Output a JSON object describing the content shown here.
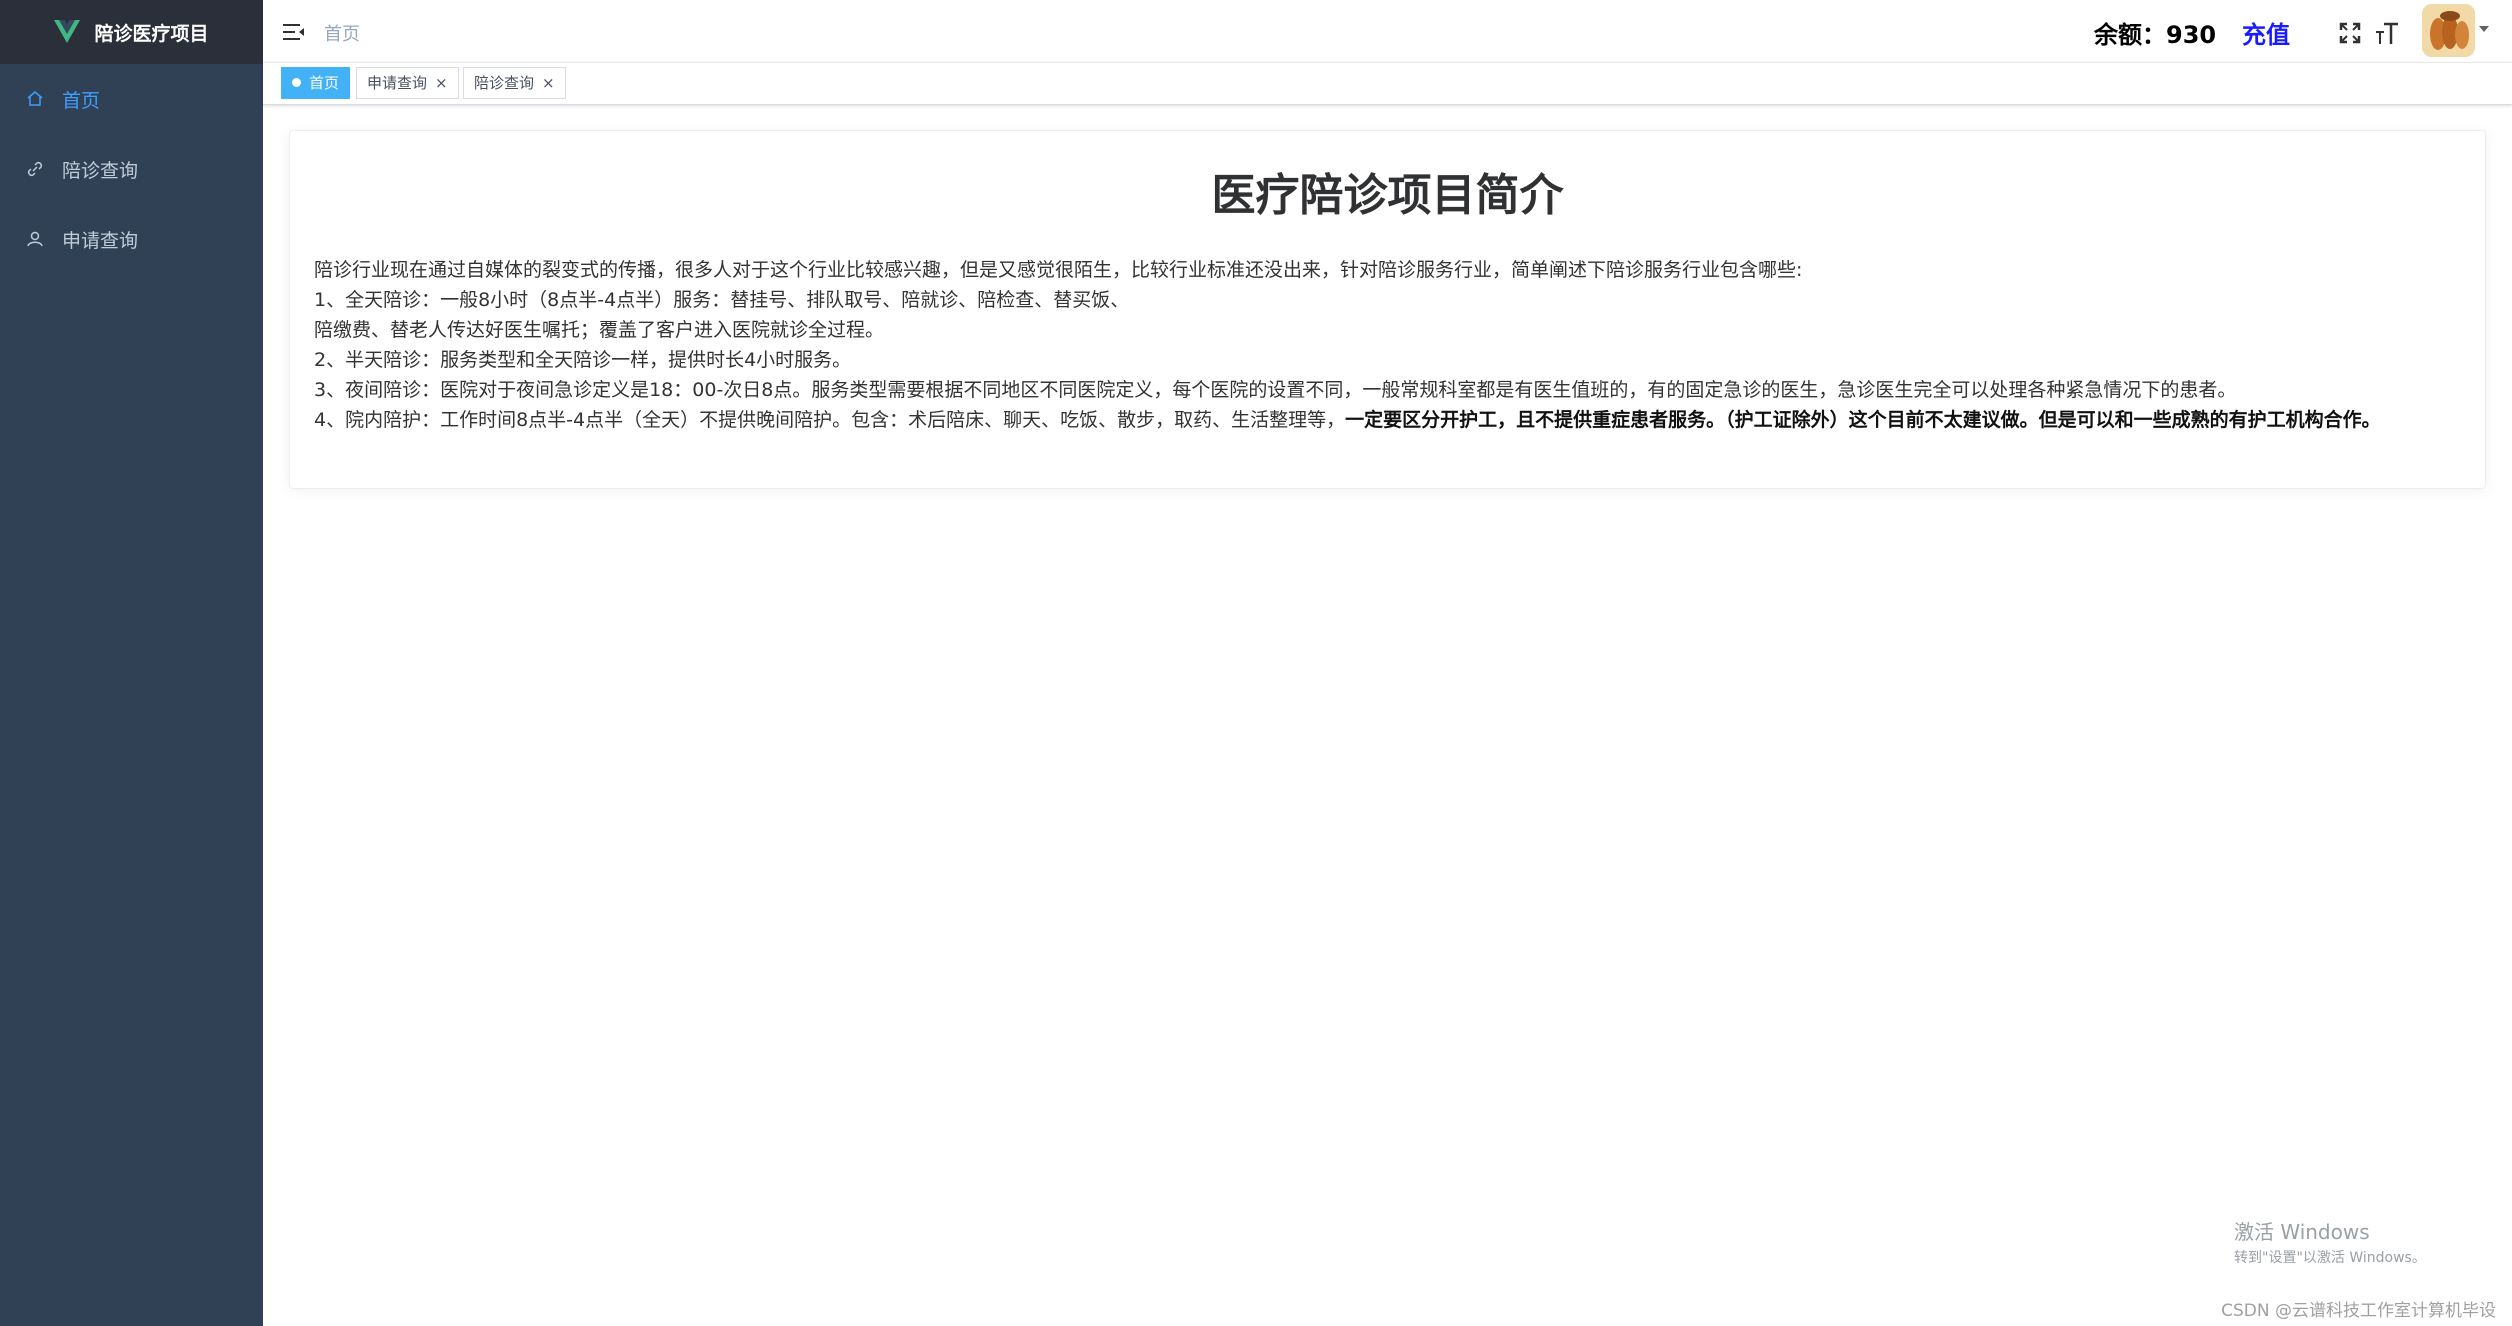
{
  "sidebar": {
    "title": "陪诊医疗项目",
    "items": [
      {
        "label": "首页",
        "icon": "home-icon",
        "active": true
      },
      {
        "label": "陪诊查询",
        "icon": "link-icon",
        "active": false
      },
      {
        "label": "申请查询",
        "icon": "user-icon",
        "active": false
      }
    ]
  },
  "header": {
    "breadcrumb": "首页",
    "balance_label": "余额：",
    "balance_value": "930",
    "recharge_label": "充值"
  },
  "tags": [
    {
      "label": "首页",
      "active": true
    },
    {
      "label": "申请查询",
      "close": "×"
    },
    {
      "label": "陪诊查询",
      "close": "×"
    }
  ],
  "content": {
    "title": "医疗陪诊项目简介",
    "p1": "陪诊行业现在通过自媒体的裂变式的传播，很多人对于这个行业比较感兴趣，但是又感觉很陌生，比较行业标准还没出来，针对陪诊服务行业，简单阐述下陪诊服务行业包含哪些:",
    "p2": "1、全天陪诊：一般8小时（8点半-4点半）服务：替挂号、排队取号、陪就诊、陪检查、替买饭、",
    "p3": "陪缴费、替老人传达好医生嘱托；覆盖了客户进入医院就诊全过程。",
    "p4": "2、半天陪诊：服务类型和全天陪诊一样，提供时长4小时服务。",
    "p5": "3、夜间陪诊：医院对于夜间急诊定义是18：00-次日8点。服务类型需要根据不同地区不同医院定义，每个医院的设置不同，一般常规科室都是有医生值班的，有的固定急诊的医生，急诊医生完全可以处理各种紧急情况下的患者。",
    "p6_normal": "4、院内陪护：工作时间8点半-4点半（全天）不提供晚间陪护。包含：术后陪床、聊天、吃饭、散步，取药、生活整理等，",
    "p6_bold": "一定要区分开护工，且不提供重症患者服务。（护工证除外）这个目前不太建议做。但是可以和一些成熟的有护工机构合作。"
  },
  "watermark": {
    "activate_line1": "激活 Windows",
    "activate_line2": "转到\"设置\"以激活 Windows。",
    "csdn": "CSDN @云谱科技工作室计算机毕设"
  },
  "colors": {
    "sidebar_bg": "#304156",
    "logo_bg": "#2b2f3a",
    "accent": "#409eff",
    "tag_active": "#42b1f5",
    "recharge": "#1a1aff",
    "logo_green": "#41b883"
  }
}
